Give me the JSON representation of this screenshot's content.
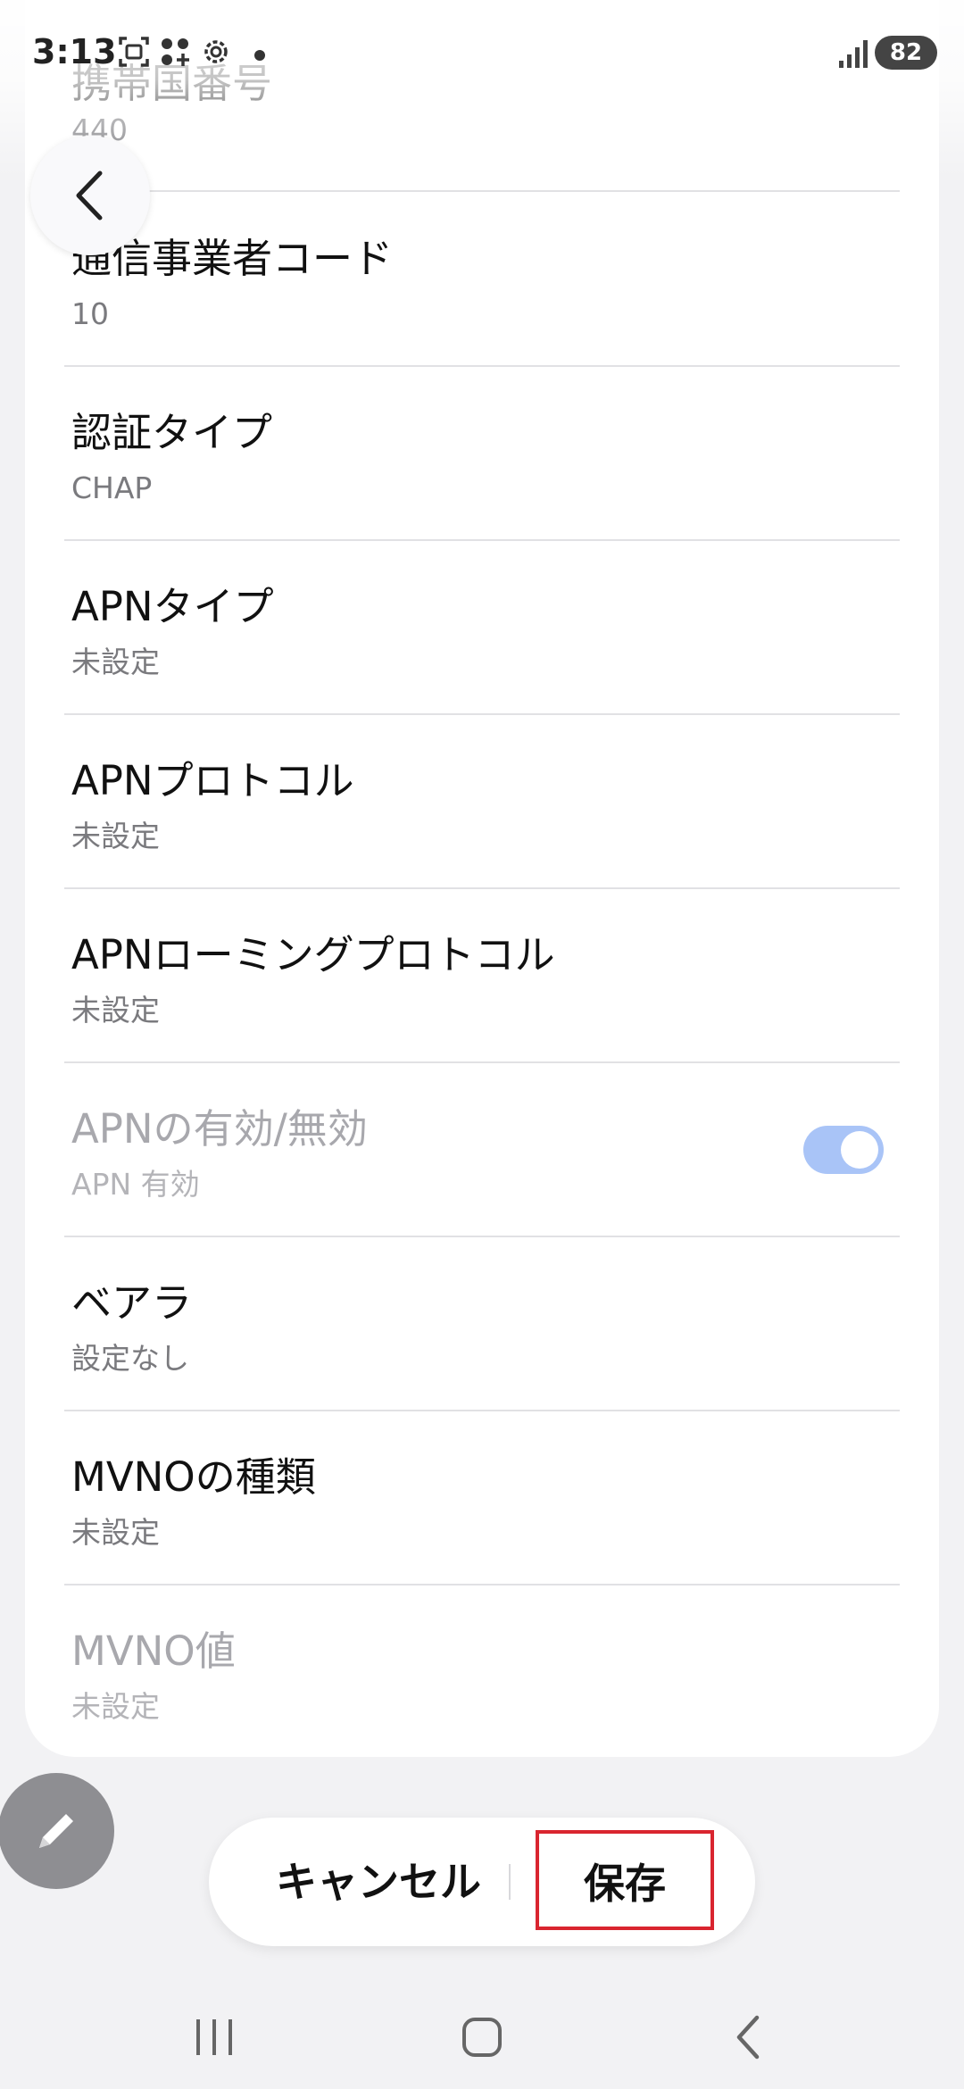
{
  "status_bar": {
    "time": "3:13",
    "battery": "82",
    "icons": [
      "screenshot-icon",
      "grid-apps-icon",
      "settings-gear-icon",
      "notification-dot-icon",
      "signal-icon"
    ]
  },
  "settings": {
    "rows": [
      {
        "title": "携帯国番号",
        "value": "440"
      },
      {
        "title": "通信事業者コード",
        "value": "10"
      },
      {
        "title": "認証タイプ",
        "value": "CHAP"
      },
      {
        "title": "APNタイプ",
        "value": "未設定"
      },
      {
        "title": "APNプロトコル",
        "value": "未設定"
      },
      {
        "title": "APNローミングプロトコル",
        "value": "未設定"
      },
      {
        "title": "APNの有効/無効",
        "value": "APN 有効",
        "toggle": true,
        "disabled": true
      },
      {
        "title": "ベアラ",
        "value": "設定なし"
      },
      {
        "title": "MVNOの種類",
        "value": "未設定"
      },
      {
        "title": "MVNO値",
        "value": "未設定",
        "disabled": true
      }
    ]
  },
  "actions": {
    "cancel_label": "キャンセル",
    "save_label": "保存"
  },
  "colors": {
    "toggle_on": "#a9c4f7",
    "highlight_border": "#d9252f",
    "fab": "#8e8e92"
  }
}
